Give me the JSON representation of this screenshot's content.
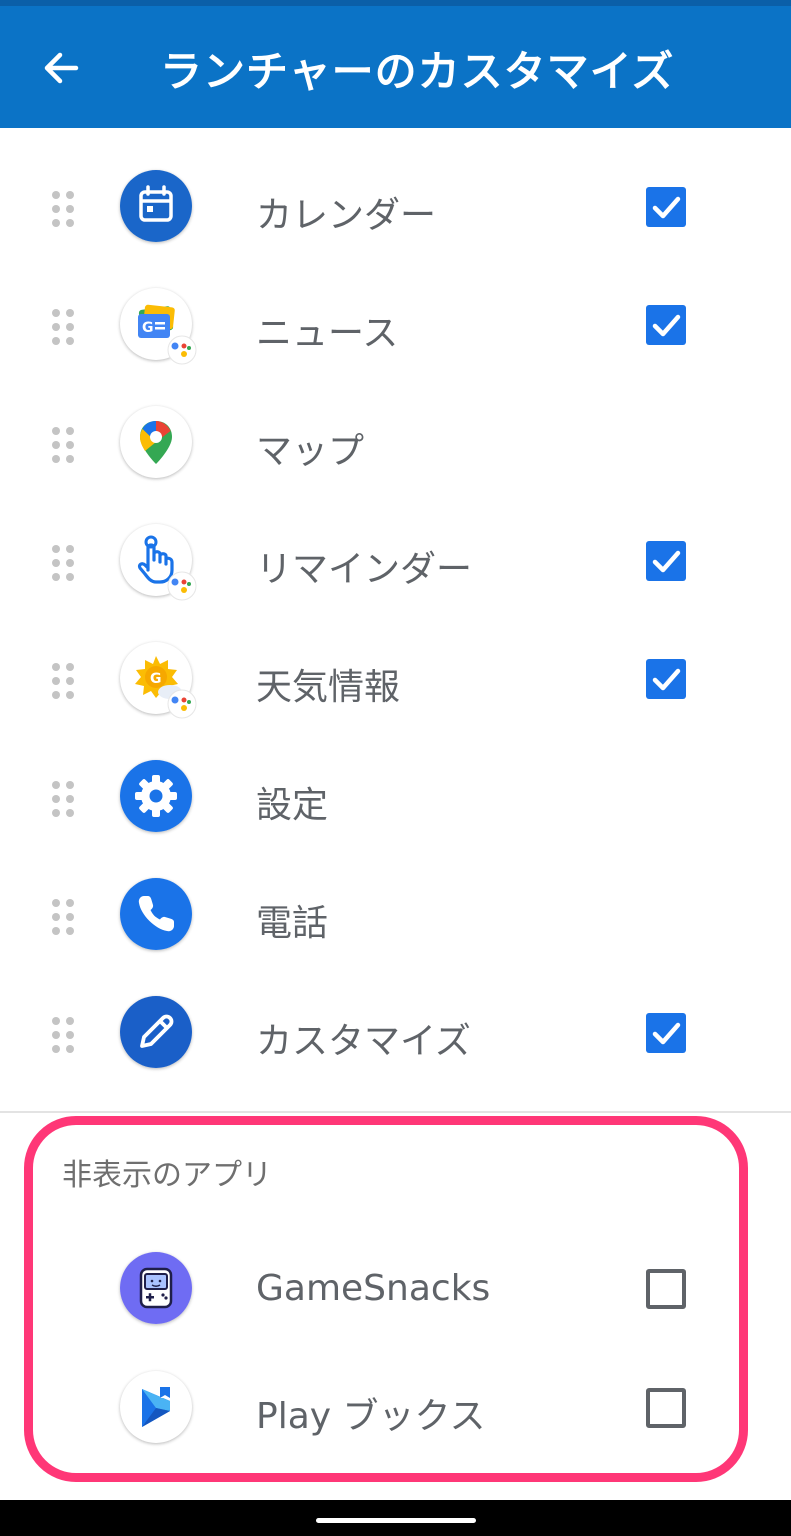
{
  "header": {
    "title": "ランチャーのカスタマイズ"
  },
  "apps": [
    {
      "label": "カレンダー",
      "icon": "calendar-icon",
      "checked": true
    },
    {
      "label": "ニュース",
      "icon": "google-news-icon",
      "checked": true
    },
    {
      "label": "マップ",
      "icon": "maps-pin-icon",
      "checked": false
    },
    {
      "label": "リマインダー",
      "icon": "reminder-hand-icon",
      "checked": true
    },
    {
      "label": "天気情報",
      "icon": "weather-sun-icon",
      "checked": true
    },
    {
      "label": "設定",
      "icon": "gear-icon",
      "checked": false
    },
    {
      "label": "電話",
      "icon": "phone-icon",
      "checked": false
    },
    {
      "label": "カスタマイズ",
      "icon": "pencil-icon",
      "checked": true
    }
  ],
  "hidden_section": {
    "title": "非表示のアプリ",
    "apps": [
      {
        "label": "GameSnacks",
        "icon": "gamesnacks-icon",
        "checked": false
      },
      {
        "label": "Play ブックス",
        "icon": "play-books-icon",
        "checked": false
      }
    ]
  },
  "colors": {
    "appbar": "#0b73c6",
    "checkbox_checked": "#1a73e8",
    "highlight": "#ff3777",
    "label_text": "#5f6368"
  }
}
